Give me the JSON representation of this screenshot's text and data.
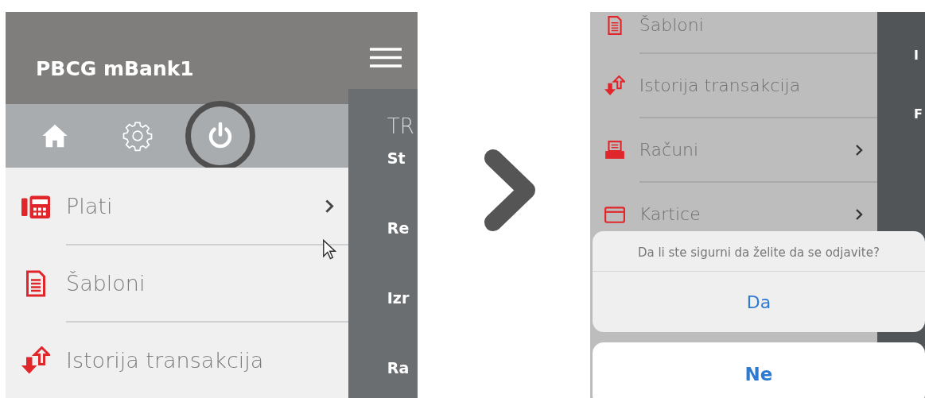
{
  "left_screen": {
    "header": {
      "title": "PBCG mBank1"
    },
    "toolbar": [
      {
        "kind": "home",
        "highlighted": false
      },
      {
        "kind": "settings",
        "highlighted": false
      },
      {
        "kind": "power",
        "highlighted": true
      }
    ],
    "menu": [
      {
        "kind": "payment",
        "label": "Plati",
        "has_submenu": true
      },
      {
        "kind": "template",
        "label": "Šabloni",
        "has_submenu": false
      },
      {
        "kind": "history",
        "label": "Istorija transakcija",
        "has_submenu": false
      }
    ],
    "side_panel": [
      {
        "kind": "heading",
        "text": "TR"
      },
      {
        "kind": "item",
        "text": "St"
      },
      {
        "kind": "item",
        "text": "Re"
      },
      {
        "kind": "item",
        "text": "Izr"
      },
      {
        "kind": "item",
        "text": "Ra"
      }
    ]
  },
  "right_screen": {
    "menu": [
      {
        "kind": "template",
        "label": "Šabloni",
        "has_submenu": false
      },
      {
        "kind": "history",
        "label": "Istorija transakcija",
        "has_submenu": false
      },
      {
        "kind": "accounts",
        "label": "Računi",
        "has_submenu": true
      },
      {
        "kind": "cards",
        "label": "Kartice",
        "has_submenu": true
      }
    ],
    "side_panel": [
      {
        "text": "I"
      },
      {
        "text": "F"
      }
    ],
    "dialog": {
      "message": "Da li ste sigurni da želite da se odjavite?",
      "confirm": "Da",
      "cancel": "Ne"
    }
  }
}
